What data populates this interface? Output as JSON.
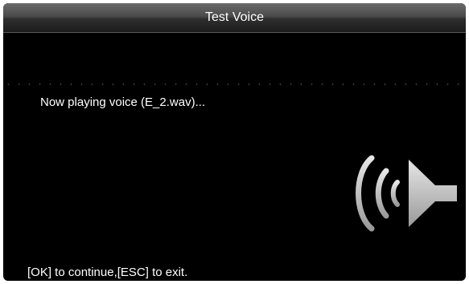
{
  "window": {
    "title": "Test Voice"
  },
  "main": {
    "message": "Now playing voice (E_2.wav)..."
  },
  "footer": {
    "hint": "[OK] to continue,[ESC] to exit."
  },
  "icons": {
    "speaker": "speaker-sound-icon"
  },
  "colors": {
    "background": "#000000",
    "text": "#ffffff",
    "icon": "#c8c8c8"
  }
}
